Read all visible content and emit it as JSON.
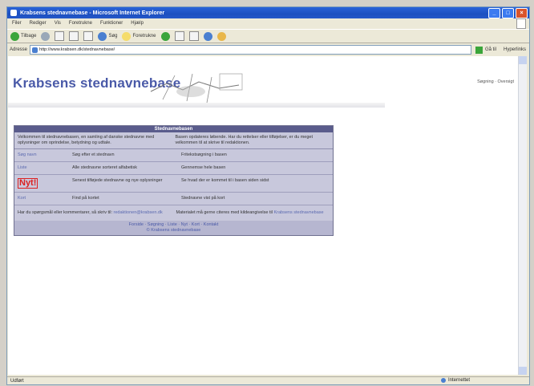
{
  "window": {
    "title": "Krabsens stednavnebase - Microsoft Internet Explorer",
    "buttons": [
      "_",
      "□",
      "×"
    ]
  },
  "menu": [
    "Filer",
    "Rediger",
    "Vis",
    "Foretrukne",
    "Funktioner",
    "Hjælp"
  ],
  "toolbar": {
    "back_label": "Tilbage",
    "search_label": "Søg",
    "favorites_label": "Foretrukne"
  },
  "address": {
    "label": "Adresse",
    "url": "http://www.krabsen.dk/stednavnebase/",
    "go_label": "Gå til",
    "links_label": "Hyperlinks"
  },
  "page": {
    "site_title": "Krabsens stednavnebase",
    "top_right": "Søgning · Oversigt",
    "panel_title": "Stednavnebasen",
    "intro_left": "Velkommen til stednavnebasen, en samling af danske stednavne med oplysninger om oprindelse, betydning og udtale.",
    "intro_right": "Basen opdateres løbende. Har du rettelser eller tilføjelser, er du meget velkommen til at skrive til redaktionen.",
    "rows": [
      {
        "c1": "Søg navn",
        "c2": "Søg efter et stednavn",
        "c3": "Fritekstsøgning i basen"
      },
      {
        "c1": "Liste",
        "c2": "Alle stednavne sorteret alfabetisk",
        "c3": "Gennemse hele basen"
      },
      {
        "c1": "Nyt!",
        "c2": "Senest tilføjede stednavne og nye oplysninger",
        "c3": "Se hvad der er kommet til i basen siden sidst"
      },
      {
        "c1": "Kort",
        "c2": "Find på kortet",
        "c3": "Stednavne vist på kort"
      }
    ],
    "foot_left": "Har du spørgsmål eller kommentarer, så skriv til: ",
    "foot_left_link": "redaktionen@krabsen.dk",
    "foot_right": "Materialet må gerne citeres med kildeangivelse til ",
    "foot_right_link": "Krabsens stednavnebase",
    "links_line1": "Forside · Søgning · Liste · Nyt · Kort · Kontakt",
    "links_line2": "© Krabsens stednavnebase"
  },
  "status": {
    "left": "Udført",
    "zone": "Internettet"
  }
}
